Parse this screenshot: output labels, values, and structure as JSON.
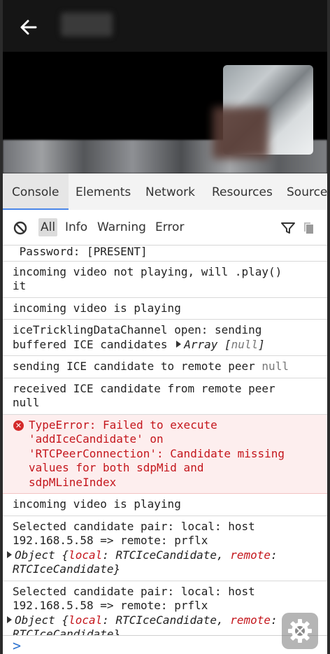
{
  "tabs": [
    "Console",
    "Elements",
    "Network",
    "Resources",
    "Sources"
  ],
  "filters": {
    "all": "All",
    "info": "Info",
    "warning": "Warning",
    "error": "Error"
  },
  "logs": {
    "l1": "Password: [PRESENT]",
    "l2": "incoming video not playing, will .play()\nit",
    "l3": "incoming video is playing",
    "l4_text": "iceTricklingDataChannel open: sending\nbuffered ICE candidates ",
    "l4_array": "Array [",
    "l4_null": "null",
    "l4_close": "]",
    "l5_text": "sending ICE candidate to remote peer ",
    "l5_null": "null",
    "l6": "received ICE candidate from remote peer\nnull",
    "err": "TypeError: Failed to execute\n'addIceCandidate' on\n'RTCPeerConnection': Candidate missing\nvalues for both sdpMid and\nsdpMLineIndex",
    "l8": "incoming video is playing",
    "l9_text": "Selected candidate pair: local: host\n192.168.5.58 => remote: prflx",
    "obj_prefix": "Object {",
    "obj_local": "local",
    "obj_mid": ": RTCIceCandidate, ",
    "obj_remote": "remote",
    "obj_colon": ":",
    "obj_end": "RTCIceCandidate}",
    "l10_text": "Selected candidate pair: local: host\n192.168.5.58 => remote: prflx"
  },
  "prompt_caret": ">",
  "icons": [
    "back-arrow-icon",
    "clear-console-icon",
    "filter-icon",
    "copy-icon",
    "settings-gear-icon",
    "error-icon",
    "expand-triangle-icon"
  ],
  "colors": {
    "error_text": "#c4161c",
    "error_bg": "#fdeeee",
    "accent": "#4a86e8"
  }
}
